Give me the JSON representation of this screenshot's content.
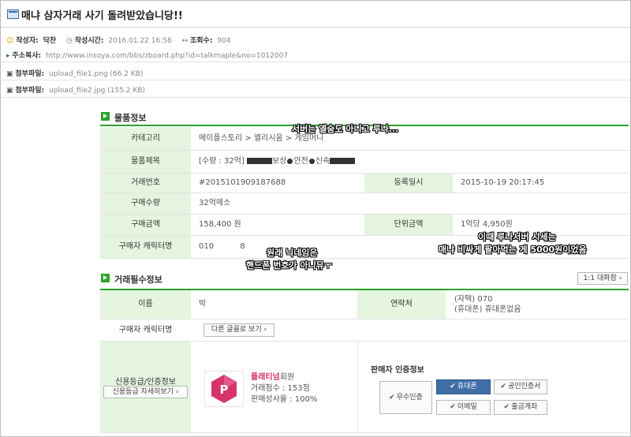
{
  "post": {
    "title": "매냐 삼자거래 사기 돌려받았습니당!!",
    "author_label": "작성자:",
    "author": "닥찬",
    "time_label": "작성시간:",
    "time": "2016.01.22 16:58",
    "views_label": "조회수:",
    "views": "904",
    "url_label": "주소복사:",
    "url": "http://www.insoya.com/bbs/zboard.php?id=talkmaple&no=1012007",
    "attachments": [
      {
        "label": "첨부파일:",
        "file": "upload_file1.png (66.2 KB)"
      },
      {
        "label": "첨부파일:",
        "file": "upload_file2.jpg (155.2 KB)"
      }
    ]
  },
  "product": {
    "section_title": "물품정보",
    "category_label": "카테고리",
    "category": "메이플스토리 > 엘리시움 > 게임머니",
    "item_title_label": "물품제목",
    "item_title_prefix": "[수량 : 32억]",
    "item_title_mid1": "보상",
    "item_title_mid2": "안전",
    "item_title_mid3": "신속",
    "trade_no_label": "거래번호",
    "trade_no": "#2015101909187688",
    "reg_date_label": "등록일시",
    "reg_date": "2015-10-19 20:17:45",
    "qty_label": "구매수량",
    "qty": "32억메소",
    "amount_label": "구매금액",
    "amount": "158,400 원",
    "unit_label": "단위금액",
    "unit": "1억당 4,950원",
    "buyer_char_label": "구매자 캐릭터명",
    "buyer_char_a": "010",
    "buyer_char_b": "8"
  },
  "trade": {
    "section_title": "거래필수정보",
    "convo_button": "1:1 대화함",
    "name_label": "이름",
    "name": "박",
    "contact_label": "연락처",
    "contact_home": "(자택) 070",
    "contact_mobile": "(휴대폰) 휴대폰없음",
    "buyer_char_label": "구매자 캐릭터명",
    "font_button": "다른 글꼴로 보기",
    "credit_label": "신용등급/인증정보",
    "credit_button": "신용등급 자세히보기",
    "grade_name": "플래티넘",
    "grade_suffix": "회원",
    "score_line": "거래점수 : 153점",
    "rate_line": "판매성사율 : 100%",
    "seller_auth_title": "판매자 인증정보",
    "auth_excellent": "우수인증",
    "auth_phone": "휴대폰",
    "auth_cert": "공인인증서",
    "auth_email": "이메일",
    "auth_account": "출금계좌"
  },
  "annotations": {
    "a1": "서버는 엘숨도 아니고 루나...",
    "a2": "원래 닉네임은",
    "a3": "핸드폰 번호가 아니뮤ㅜ",
    "a4": "이때 루나서버 시세는",
    "a5": "매냐 비싸게 팔아먹는 게 5000원이었음"
  },
  "colors": {
    "accent_green": "#2aa32a",
    "label_bg": "#e5f5df",
    "platinum": "#d6336c"
  }
}
